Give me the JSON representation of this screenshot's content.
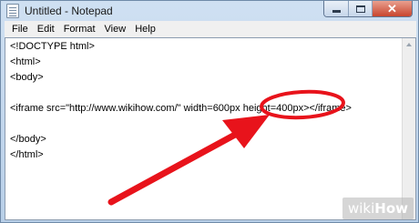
{
  "window": {
    "title": "Untitled - Notepad",
    "controls": {
      "minimize": "–",
      "maximize": "□",
      "close": "✕"
    }
  },
  "menu": [
    "File",
    "Edit",
    "Format",
    "View",
    "Help"
  ],
  "editor": {
    "lines": [
      "<!DOCTYPE html>",
      "<html>",
      "<body>",
      "",
      "<iframe src=\"http://www.wikihow.com/\" width=600px height=400px></iframe>",
      "",
      "</body>",
      "</html>"
    ]
  },
  "annotation": {
    "highlight": "height=400px",
    "color": "#e8131b"
  },
  "watermark": {
    "wiki": "wiki",
    "how": "How"
  }
}
